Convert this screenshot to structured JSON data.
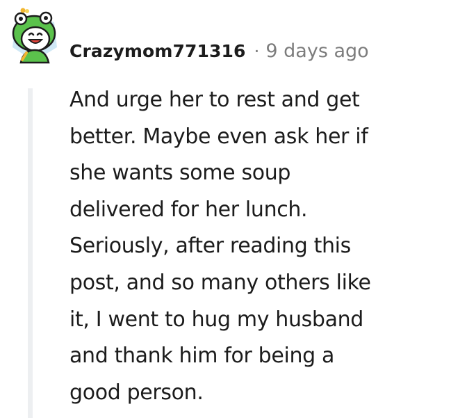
{
  "comment": {
    "author": "Crazymom771316",
    "separator": "·",
    "timestamp": "9 days ago",
    "body_lines": [
      "And urge her to rest and get",
      "better. Maybe even ask her if",
      "she wants some soup",
      "delivered for her lunch.",
      "Seriously, after reading this",
      "post, and so many others like",
      "it, I went to hug my husband",
      "and thank him for being a",
      "good person."
    ]
  },
  "avatar": {
    "icon": "snoo-frog-hat-avatar",
    "colors": {
      "hat": "#5bc24c",
      "face": "#ffffff",
      "background": "#cfe8f5"
    }
  },
  "colors": {
    "text": "#1c1c1c",
    "muted": "#7c7c7c",
    "thread_line": "#edeff1"
  }
}
